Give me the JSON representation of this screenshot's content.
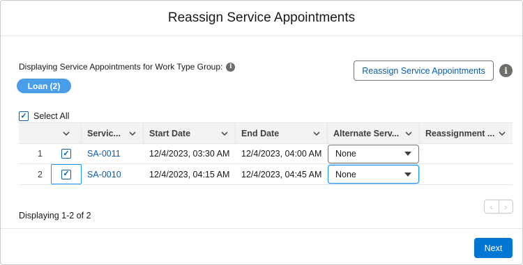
{
  "modal": {
    "title": "Reassign Service Appointments"
  },
  "work_type": {
    "label": "Displaying Service Appointments for Work Type Group:",
    "info_icon": "info-icon",
    "group_pill": "Loan (2)"
  },
  "actions": {
    "reassign_label": "Reassign Service Appointments",
    "info_icon": "info-icon"
  },
  "select_all": {
    "label": "Select All",
    "checked": true
  },
  "table": {
    "columns": [
      {
        "label": ""
      },
      {
        "label": ""
      },
      {
        "label": "Servic..."
      },
      {
        "label": "Start Date"
      },
      {
        "label": "End Date"
      },
      {
        "label": "Alternate Serv..."
      },
      {
        "label": "Reassignment ..."
      }
    ],
    "rows": [
      {
        "num": "1",
        "checked": true,
        "service": "SA-0011",
        "start": "12/4/2023, 03:30 AM",
        "end": "12/4/2023, 04:00 AM",
        "alternate": "None",
        "reassignment": ""
      },
      {
        "num": "2",
        "checked": true,
        "service": "SA-0010",
        "start": "12/4/2023, 04:15 AM",
        "end": "12/4/2023, 04:45 AM",
        "alternate": "None",
        "reassignment": ""
      }
    ]
  },
  "pagination": {
    "text": "Displaying 1-2 of 2",
    "prev_icon": "chevron-left-icon",
    "next_icon": "chevron-right-icon"
  },
  "footer": {
    "next_label": "Next"
  },
  "colors": {
    "brand": "#0176d3",
    "link": "#0b5cab",
    "pill": "#4a9de9",
    "focus": "#1b96ff"
  }
}
